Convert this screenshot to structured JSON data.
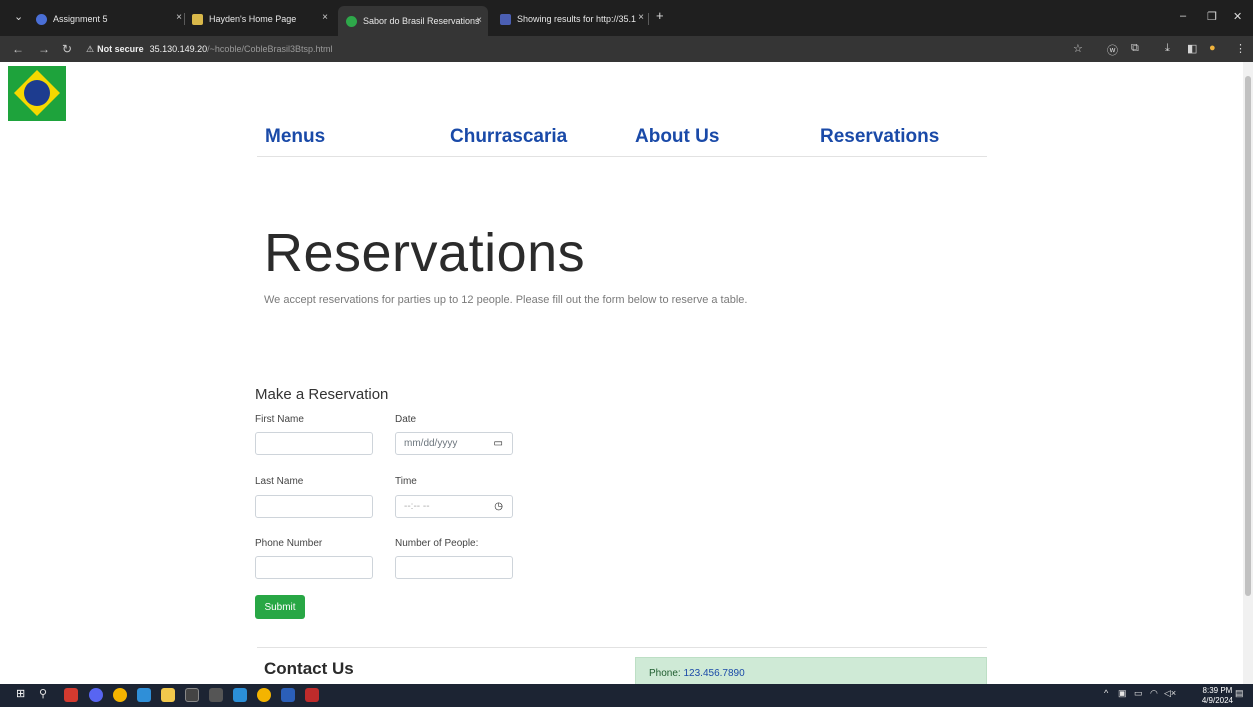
{
  "browser": {
    "tabs": [
      {
        "title": "Assignment 5",
        "close": "×"
      },
      {
        "title": "Hayden's Home Page",
        "close": "×"
      },
      {
        "title": "Sabor do Brasil Reservations",
        "close": "×"
      },
      {
        "title": "Showing results for http://35.1",
        "close": "×"
      }
    ],
    "new_tab": "+",
    "security": "Not secure",
    "url_host": "35.130.149.20",
    "url_path": "/~hcoble/CobleBrasil3Btsp.html"
  },
  "nav": {
    "menus": "Menus",
    "churrascaria": "Churrascaria",
    "about": "About Us",
    "reservations": "Reservations"
  },
  "page": {
    "title": "Reservations",
    "lead": "We accept reservations for parties up to 12 people. Please fill out the form below to reserve a table."
  },
  "form": {
    "title": "Make a Reservation",
    "first_name": "First Name",
    "last_name": "Last Name",
    "phone": "Phone Number",
    "date": "Date",
    "date_placeholder": "mm/dd/yyyy",
    "time": "Time",
    "time_placeholder": "--:-- --",
    "people": "Number of People:",
    "submit": "Submit"
  },
  "contact": {
    "title": "Contact Us",
    "phone_label": "Phone: ",
    "phone_number": "123.456.7890"
  },
  "taskbar": {
    "time": "8:39 PM",
    "date": "4/9/2024"
  },
  "colors": {
    "nav_link": "#1a4aa8",
    "submit_bg": "#28a745",
    "contact_box": "#cfead6"
  }
}
